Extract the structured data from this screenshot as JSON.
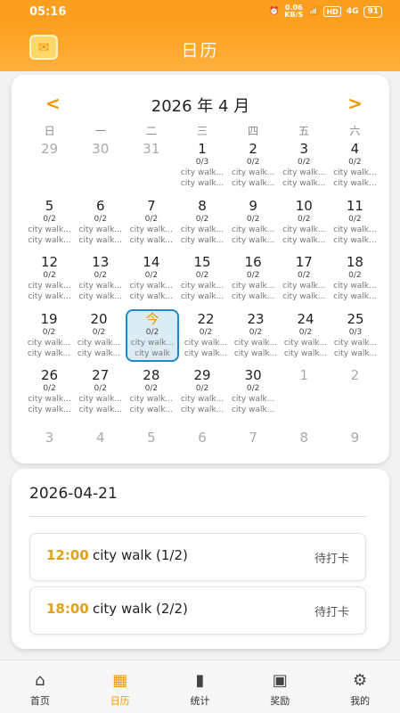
{
  "status_bar": {
    "time": "05:16",
    "net_speed": "0.06",
    "net_unit": "KB/S",
    "hd": "HD",
    "signal": "4G",
    "battery": "91"
  },
  "header": {
    "title": "日历"
  },
  "calendar": {
    "month_label": "2026 年 4 月",
    "prev": "<",
    "next": ">",
    "weekdays": [
      "日",
      "一",
      "二",
      "三",
      "四",
      "五",
      "六"
    ],
    "today_label": "今",
    "rows": [
      [
        {
          "num": "29",
          "other": true
        },
        {
          "num": "30",
          "other": true
        },
        {
          "num": "31",
          "other": true
        },
        {
          "num": "1",
          "count": "0/3",
          "ev1": "city walk...",
          "ev2": "city walk..."
        },
        {
          "num": "2",
          "count": "0/2",
          "ev1": "city walk...",
          "ev2": "city walk..."
        },
        {
          "num": "3",
          "count": "0/2",
          "ev1": "city walk...",
          "ev2": "city walk..."
        },
        {
          "num": "4",
          "count": "0/2",
          "ev1": "city walk...",
          "ev2": "city walk..."
        }
      ],
      [
        {
          "num": "5",
          "count": "0/2",
          "ev1": "city walk...",
          "ev2": "city walk..."
        },
        {
          "num": "6",
          "count": "0/2",
          "ev1": "city walk...",
          "ev2": "city walk..."
        },
        {
          "num": "7",
          "count": "0/2",
          "ev1": "city walk...",
          "ev2": "city walk..."
        },
        {
          "num": "8",
          "count": "0/2",
          "ev1": "city walk...",
          "ev2": "city walk..."
        },
        {
          "num": "9",
          "count": "0/2",
          "ev1": "city walk...",
          "ev2": "city walk..."
        },
        {
          "num": "10",
          "count": "0/2",
          "ev1": "city walk...",
          "ev2": "city walk..."
        },
        {
          "num": "11",
          "count": "0/2",
          "ev1": "city walk...",
          "ev2": "city walk..."
        }
      ],
      [
        {
          "num": "12",
          "count": "0/2",
          "ev1": "city walk...",
          "ev2": "city walk..."
        },
        {
          "num": "13",
          "count": "0/2",
          "ev1": "city walk...",
          "ev2": "city walk..."
        },
        {
          "num": "14",
          "count": "0/2",
          "ev1": "city walk...",
          "ev2": "city walk..."
        },
        {
          "num": "15",
          "count": "0/2",
          "ev1": "city walk...",
          "ev2": "city walk..."
        },
        {
          "num": "16",
          "count": "0/2",
          "ev1": "city walk...",
          "ev2": "city walk..."
        },
        {
          "num": "17",
          "count": "0/2",
          "ev1": "city walk...",
          "ev2": "city walk..."
        },
        {
          "num": "18",
          "count": "0/2",
          "ev1": "city walk...",
          "ev2": "city walk..."
        }
      ],
      [
        {
          "num": "19",
          "count": "0/2",
          "ev1": "city walk...",
          "ev2": "city walk..."
        },
        {
          "num": "20",
          "count": "0/2",
          "ev1": "city walk...",
          "ev2": "city walk..."
        },
        {
          "num": "今",
          "count": "0/2",
          "ev1": "city walk...",
          "ev2": "city walk",
          "today": true
        },
        {
          "num": "22",
          "count": "0/2",
          "ev1": "city walk...",
          "ev2": "city walk..."
        },
        {
          "num": "23",
          "count": "0/2",
          "ev1": "city walk...",
          "ev2": "city walk..."
        },
        {
          "num": "24",
          "count": "0/2",
          "ev1": "city walk...",
          "ev2": "city walk..."
        },
        {
          "num": "25",
          "count": "0/3",
          "ev1": "city walk...",
          "ev2": "city walk..."
        }
      ],
      [
        {
          "num": "26",
          "count": "0/2",
          "ev1": "city walk...",
          "ev2": "city walk..."
        },
        {
          "num": "27",
          "count": "0/2",
          "ev1": "city walk...",
          "ev2": "city walk..."
        },
        {
          "num": "28",
          "count": "0/2",
          "ev1": "city walk...",
          "ev2": "city walk..."
        },
        {
          "num": "29",
          "count": "0/2",
          "ev1": "city walk...",
          "ev2": "city walk..."
        },
        {
          "num": "30",
          "count": "0/2",
          "ev1": "city walk...",
          "ev2": "city walk..."
        },
        {
          "num": "1",
          "other": true
        },
        {
          "num": "2",
          "other": true
        }
      ]
    ],
    "trailing": [
      "3",
      "4",
      "5",
      "6",
      "7",
      "8",
      "9"
    ]
  },
  "detail": {
    "date": "2026-04-21",
    "tasks": [
      {
        "time": "12:00",
        "name": "city walk (1/2)",
        "status": "待打卡"
      },
      {
        "time": "18:00",
        "name": "city walk (2/2)",
        "status": "待打卡"
      }
    ]
  },
  "tabbar": {
    "items": [
      {
        "label": "首页",
        "icon": "home-icon"
      },
      {
        "label": "日历",
        "icon": "calendar-icon",
        "active": true
      },
      {
        "label": "统计",
        "icon": "bar-chart-icon"
      },
      {
        "label": "奖励",
        "icon": "gift-icon"
      },
      {
        "label": "我的",
        "icon": "gear-icon"
      }
    ]
  },
  "colors": {
    "brand": "#fd9f1e",
    "accent": "#f39800",
    "today_border": "#1e88c8"
  }
}
